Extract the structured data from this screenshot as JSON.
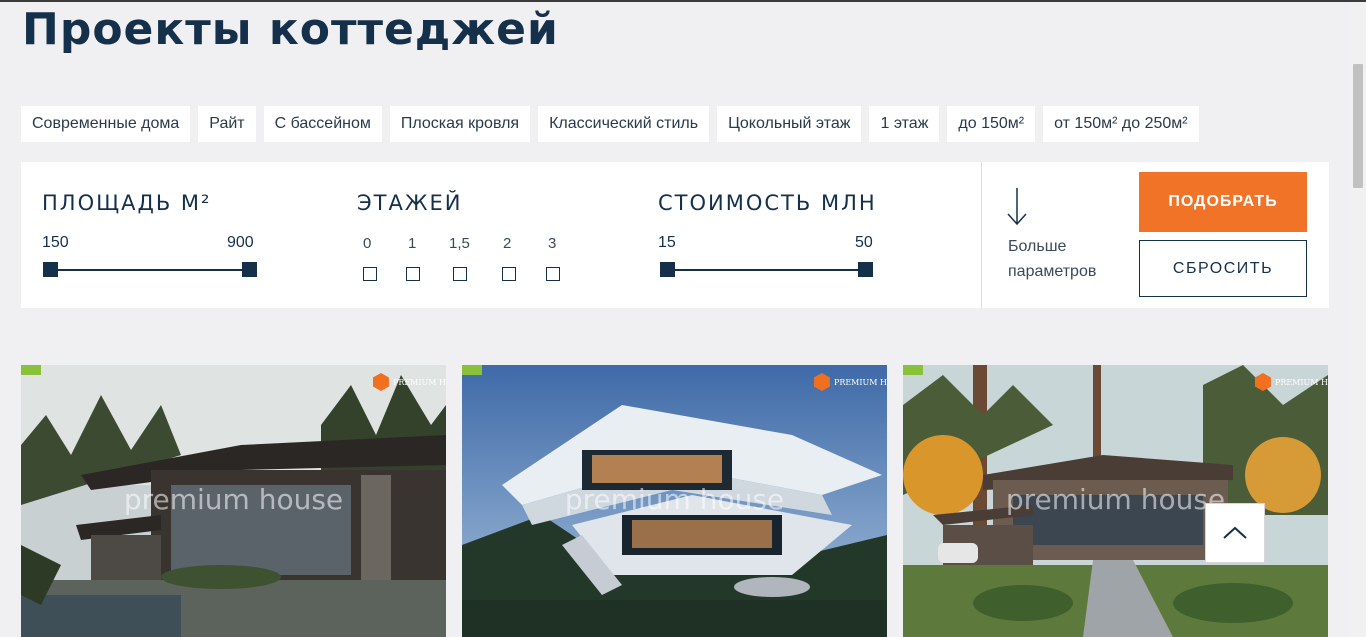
{
  "page": {
    "title": "Проекты коттеджей"
  },
  "tags": [
    "Современные дома",
    "Райт",
    "С бассейном",
    "Плоская кровля",
    "Классический стиль",
    "Цокольный этаж",
    "1 этаж",
    "до 150м²",
    "от 150м² до 250м²"
  ],
  "filter": {
    "area": {
      "title": "ПЛОЩАДЬ М²",
      "min": "150",
      "max": "900"
    },
    "floors": {
      "title": "ЭТАЖЕЙ",
      "options": [
        "0",
        "1",
        "1,5",
        "2",
        "3"
      ]
    },
    "price": {
      "title": "СТОИМОСТЬ МЛН",
      "min": "15",
      "max": "50"
    },
    "more_label_1": "Больше",
    "more_label_2": "параметров",
    "submit_label": "ПОДОБРАТЬ",
    "reset_label": "СБРОСИТЬ"
  },
  "cards": [
    {
      "watermark": "premium house",
      "logo": "PREMIUM H"
    },
    {
      "watermark": "premium house",
      "logo": "PREMIUM H"
    },
    {
      "watermark": "premium house",
      "logo": "PREMIUM H"
    }
  ],
  "colors": {
    "accent": "#f07328",
    "navy": "#15304a",
    "badge": "#8ac13a"
  },
  "icons": {
    "more": "arrow-down-icon",
    "up": "chevron-up-icon"
  }
}
